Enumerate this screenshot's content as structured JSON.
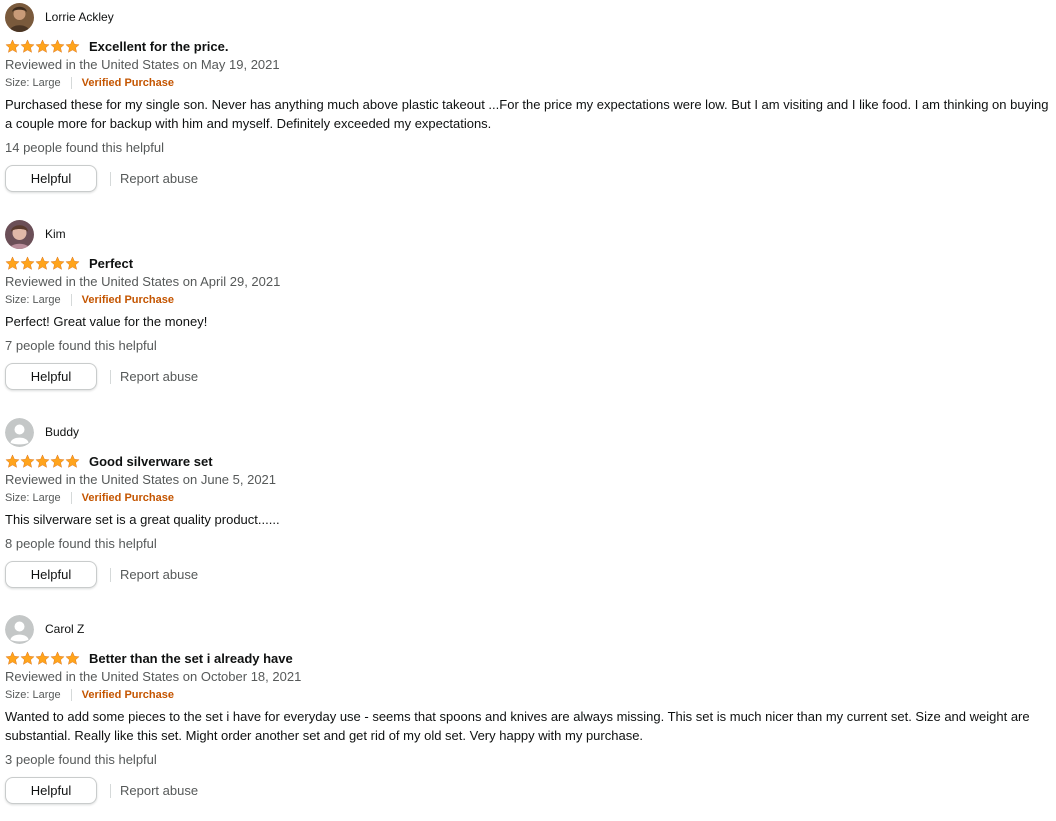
{
  "colors": {
    "star": "#ffa41c",
    "verified": "#c45500",
    "muted": "#565959"
  },
  "reviews": [
    {
      "author": "Lorrie Ackley",
      "avatar": "photo",
      "rating": 5,
      "title": "Excellent for the price.",
      "date": "Reviewed in the United States on May 19, 2021",
      "size": "Size: Large",
      "verified": "Verified Purchase",
      "body": "Purchased these for my single son. Never has anything much above plastic takeout ...For the price my expectations were low. But I am visiting and I like food. I am thinking on buying a couple more for backup with him and myself. Definitely exceeded my expectations.",
      "helpful_count": "14 people found this helpful",
      "helpful_label": "Helpful",
      "report_label": "Report abuse"
    },
    {
      "author": "Kim",
      "avatar": "photo",
      "rating": 5,
      "title": "Perfect",
      "date": "Reviewed in the United States on April 29, 2021",
      "size": "Size: Large",
      "verified": "Verified Purchase",
      "body": "Perfect! Great value for the money!",
      "helpful_count": "7 people found this helpful",
      "helpful_label": "Helpful",
      "report_label": "Report abuse"
    },
    {
      "author": "Buddy",
      "avatar": "default",
      "rating": 5,
      "title": "Good silverware set",
      "date": "Reviewed in the United States on June 5, 2021",
      "size": "Size: Large",
      "verified": "Verified Purchase",
      "body": "This silverware set is a great quality product......",
      "helpful_count": "8 people found this helpful",
      "helpful_label": "Helpful",
      "report_label": "Report abuse"
    },
    {
      "author": "Carol Z",
      "avatar": "default",
      "rating": 5,
      "title": "Better than the set i already have",
      "date": "Reviewed in the United States on October 18, 2021",
      "size": "Size: Large",
      "verified": "Verified Purchase",
      "body": "Wanted to add some pieces to the set i have for everyday use - seems that spoons and knives are always missing. This set is much nicer than my current set. Size and weight are substantial. Really like this set. Might order another set and get rid of my old set. Very happy with my purchase.",
      "helpful_count": "3 people found this helpful",
      "helpful_label": "Helpful",
      "report_label": "Report abuse"
    }
  ]
}
